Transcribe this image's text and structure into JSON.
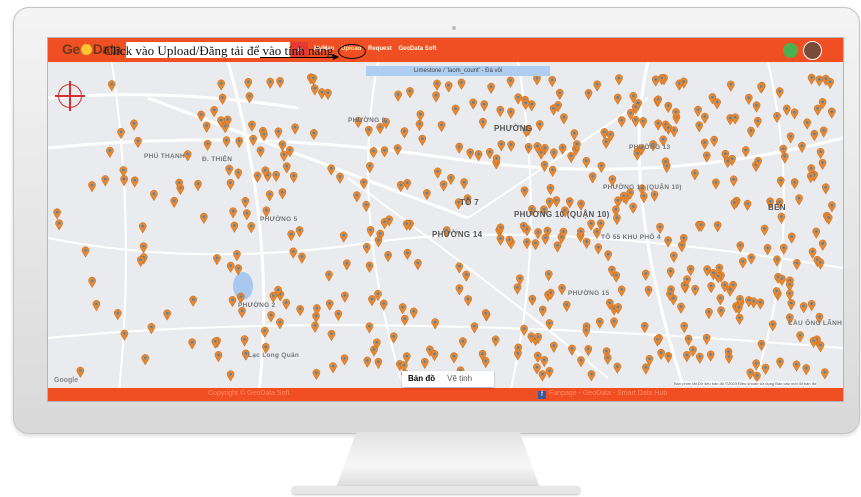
{
  "app": {
    "logo_text_left": "Ge",
    "logo_text_right": "Data",
    "search_placeholder": "",
    "search_icon": "search-icon",
    "menu": [
      "MyMap",
      "Upload",
      "Request",
      "GeoData Soft"
    ],
    "annotation": "Click vào Upload/Đăng tải để vào tính năng",
    "layer_bar": "Limestone / 'laom_count' - Đá vôi"
  },
  "map": {
    "labels": [
      {
        "text": "PHƯỜNG",
        "big": true
      },
      {
        "text": "PHƯỜNG 14",
        "big": true
      },
      {
        "text": "TÔ 7",
        "big": true
      },
      {
        "text": "PHƯỜNG 10 (QUẬN 10)",
        "big": true
      },
      {
        "text": "TÔ 55 KHU PHỐ 4",
        "big": false
      },
      {
        "text": "PHƯỜNG 12 (QUẬN 10)",
        "big": false
      },
      {
        "text": "PHƯỜNG 13",
        "big": false
      },
      {
        "text": "PHƯỜNG 2",
        "big": false
      },
      {
        "text": "PHƯỜNG 15",
        "big": false
      },
      {
        "text": "BÉN",
        "big": true
      },
      {
        "text": "PHÚ THẠNH",
        "big": false
      },
      {
        "text": "Đ. THIỆN",
        "big": false
      },
      {
        "text": "PHƯỜNG 9",
        "big": false
      },
      {
        "text": "PHƯỜNG 5",
        "big": false
      },
      {
        "text": "Lạc Long Quân",
        "big": false
      },
      {
        "text": "CẦU ÔNG LÃNH",
        "big": false
      }
    ],
    "toggle": {
      "map": "Bản đồ",
      "satellite": "Vệ tinh"
    },
    "google": "Google",
    "attribution": "Bàn phím tắt   Dữ liệu bản đồ ©2023   Điều khoản sử dụng   Báo cáo một lỗi bản đồ"
  },
  "footer": {
    "left": "Copyright © GeoData Soft",
    "right": "Fanpage - GeoData - Smart Data Hub"
  },
  "colors": {
    "brand": "#f04e23",
    "marker": "#e8872f",
    "marker_center": "#3e8ac4"
  }
}
